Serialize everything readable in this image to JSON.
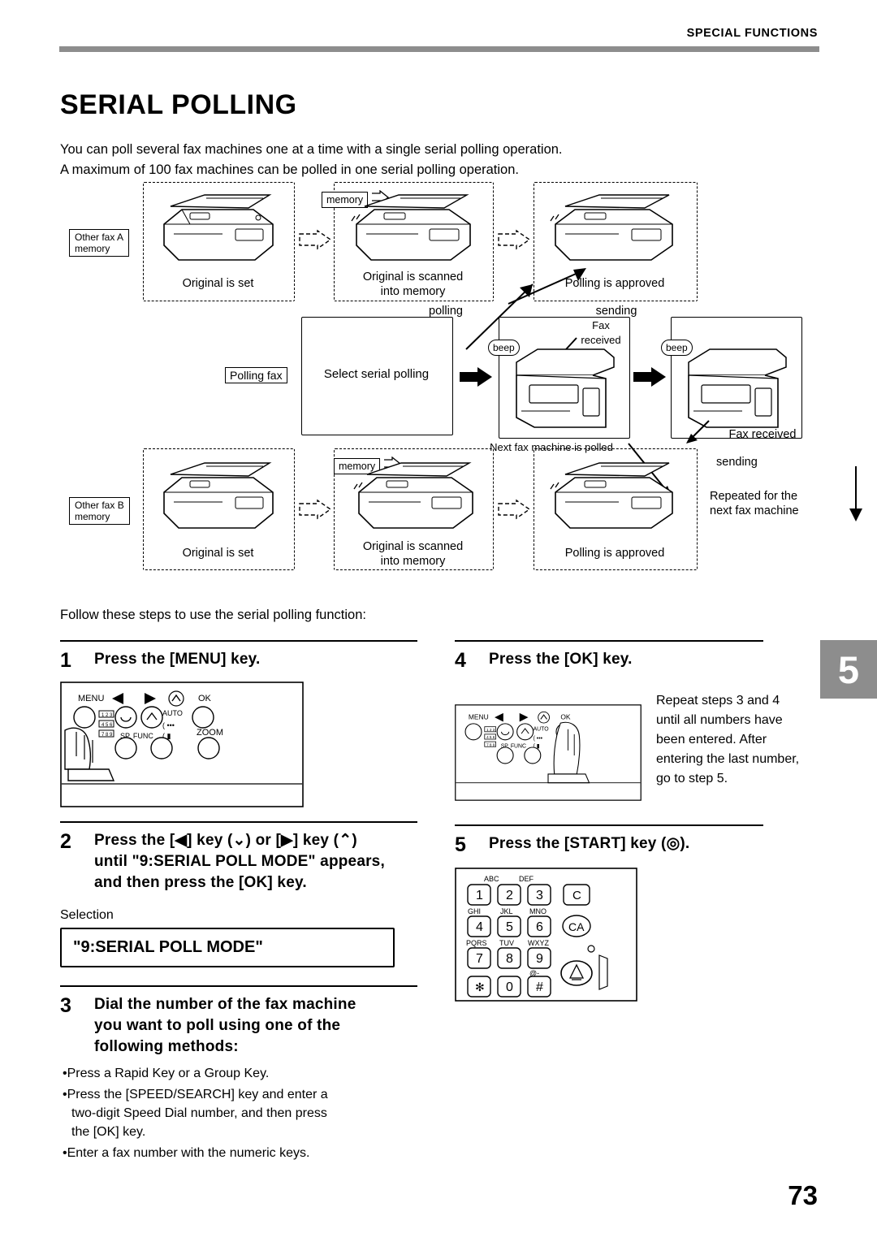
{
  "header": {
    "section": "SPECIAL FUNCTIONS"
  },
  "title": "SERIAL POLLING",
  "intro": {
    "line1": "You can poll several fax machines one at a time with a single serial polling operation.",
    "line2": "A maximum of 100 fax machines can be polled in one serial polling operation."
  },
  "diagram": {
    "other_fax_a": "Other fax A\nmemory",
    "other_fax_a_l1": "Other fax A",
    "other_fax_a_l2": "memory",
    "other_fax_b_l1": "Other fax B",
    "other_fax_b_l2": "memory",
    "memory_label": "memory",
    "beep_label": "beep",
    "original_is_set": "Original is set",
    "original_scanned_l1": "Original is scanned",
    "original_scanned_l2": "into memory",
    "polling_approved": "Polling is approved",
    "polling": "polling",
    "sending": "sending",
    "fax_received_l1": "Fax",
    "fax_received_l2": "received",
    "polling_fax": "Polling fax",
    "select_serial_polling": "Select serial polling",
    "next_fax_polled": "Next fax machine is polled",
    "fax_received": "Fax received",
    "sending2": "sending",
    "repeated_l1": "Repeated for the",
    "repeated_l2": "next fax machine"
  },
  "follow_text": "Follow these steps to use the serial polling function:",
  "steps": {
    "s1": {
      "num": "1",
      "title": "Press the [MENU] key."
    },
    "s2": {
      "num": "2",
      "line1": "Press the [",
      "line1b": "] key (",
      "line1c": ") or [",
      "line1d": "] key (",
      "line1e": ")",
      "line2": "until \"9:SERIAL POLL MODE\" appears,",
      "line3": "and then press the [OK] key.",
      "selection_label": "Selection",
      "lcd": "\"9:SERIAL POLL MODE\""
    },
    "s3": {
      "num": "3",
      "line1": "Dial the number of the fax machine",
      "line2": "you want to poll using one of the",
      "line3": "following methods:",
      "bullets": [
        "Press a Rapid Key or a Group Key.",
        "Press the [SPEED/SEARCH] key and enter a",
        "two-digit Speed Dial number, and then press",
        "the [OK] key.",
        "Enter a fax number with the numeric keys."
      ]
    },
    "s4": {
      "num": "4",
      "title": "Press the [OK] key.",
      "body_l1": "Repeat steps 3 and 4",
      "body_l2": "until all numbers have",
      "body_l3": "been entered. After",
      "body_l4": "entering the last number,",
      "body_l5": "go to step 5."
    },
    "s5": {
      "num": "5",
      "title_a": "Press the  [START] key (",
      "title_b": ")."
    }
  },
  "panel": {
    "menu": "MENU",
    "ok": "OK",
    "auto": "AUTO",
    "zoom": "ZOOM",
    "sp_func": "SP. FUNC"
  },
  "keypad": {
    "rows": [
      [
        {
          "d": "1",
          "l": ""
        },
        {
          "d": "2",
          "l": "ABC"
        },
        {
          "d": "3",
          "l": "DEF"
        }
      ],
      [
        {
          "d": "4",
          "l": "GHI"
        },
        {
          "d": "5",
          "l": "JKL"
        },
        {
          "d": "6",
          "l": "MNO"
        }
      ],
      [
        {
          "d": "7",
          "l": "PQRS"
        },
        {
          "d": "8",
          "l": "TUV"
        },
        {
          "d": "9",
          "l": "WXYZ"
        }
      ],
      [
        {
          "d": "✱",
          "l": ""
        },
        {
          "d": "0",
          "l": "@-"
        },
        {
          "d": "#",
          "l": ""
        }
      ]
    ],
    "c_key": "C",
    "ca_key": "CA"
  },
  "chapter_number": "5",
  "page_number": "73"
}
